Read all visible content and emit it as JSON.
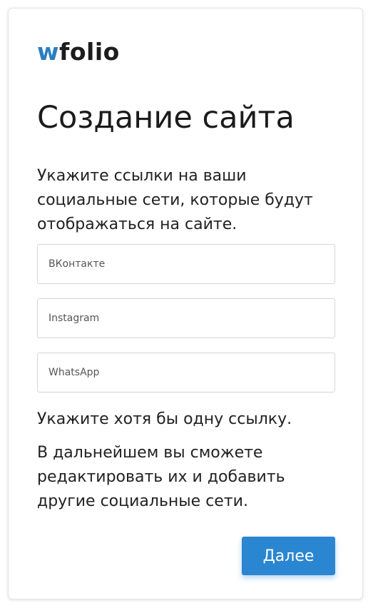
{
  "brand": {
    "logo_accent": "w",
    "logo_rest": "folio",
    "accent_color": "#2a7fc1"
  },
  "page": {
    "title": "Создание сайта",
    "intro": "Укажите ссылки на ваши социальные сети, которые будут отображаться на сайте."
  },
  "fields": {
    "vk_placeholder": "ВКонтакте",
    "instagram_placeholder": "Instagram",
    "whatsapp_placeholder": "WhatsApp"
  },
  "messages": {
    "hint": "Укажите хотя бы одну ссылку.",
    "note": "В дальнейшем вы сможете редактировать их и добавить другие социальные сети."
  },
  "actions": {
    "next_label": "Далее",
    "next_color": "#2a86d1"
  }
}
